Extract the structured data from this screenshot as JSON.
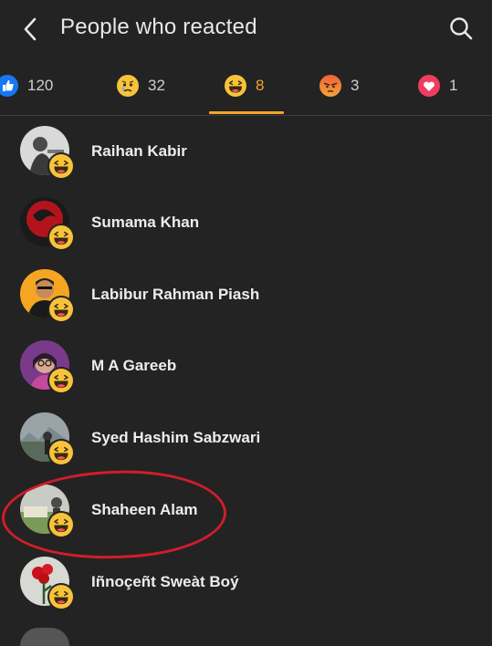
{
  "header": {
    "title": "People who reacted",
    "back_icon": "chevron-left-icon",
    "search_icon": "search-icon"
  },
  "tabs": [
    {
      "reaction": "like",
      "count": "120",
      "color": "#1877f2"
    },
    {
      "reaction": "sad",
      "count": "32",
      "color": "#f7c33b"
    },
    {
      "reaction": "haha",
      "count": "8",
      "color": "#f7c33b",
      "active": true
    },
    {
      "reaction": "angry",
      "count": "3",
      "color": "#f0623a"
    },
    {
      "reaction": "love",
      "count": "1",
      "color": "#f03d5f"
    }
  ],
  "people": [
    {
      "name": "Raihan Kabir",
      "reaction": "haha"
    },
    {
      "name": "Sumama Khan",
      "reaction": "haha"
    },
    {
      "name": "Labibur Rahman Piash",
      "reaction": "haha"
    },
    {
      "name": "M A Gareeb",
      "reaction": "haha"
    },
    {
      "name": "Syed Hashim Sabzwari",
      "reaction": "haha"
    },
    {
      "name": "Shaheen Alam",
      "reaction": "haha"
    },
    {
      "name": "Iñnoçeñt Sweàt Boý",
      "reaction": "haha"
    }
  ],
  "colors": {
    "background": "#232323",
    "accent": "#f2a52b",
    "highlight_circle": "#d11d2a"
  }
}
